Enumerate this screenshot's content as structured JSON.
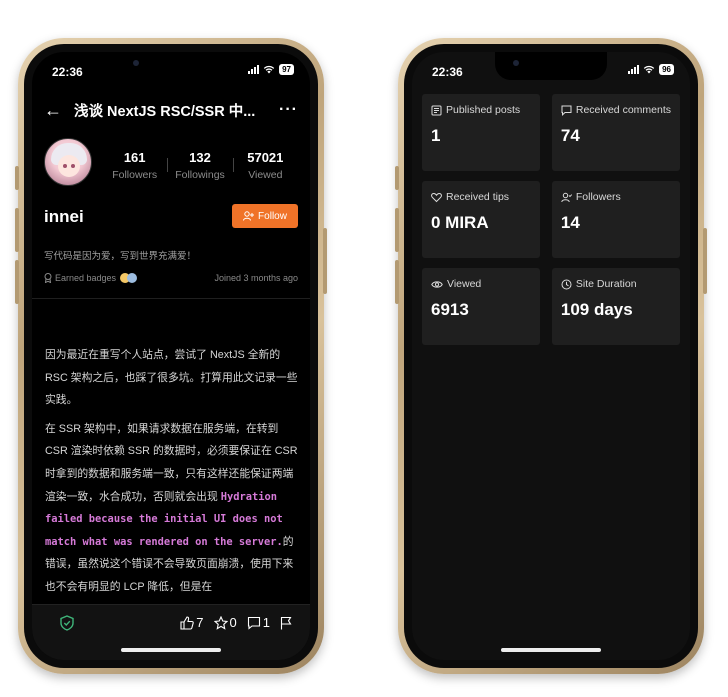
{
  "left_phone": {
    "status": {
      "time": "22:36",
      "battery": "97"
    },
    "header": {
      "back_icon": "arrow-left",
      "title": "浅谈 NextJS RSC/SSR 中...",
      "more_icon": "ellipsis"
    },
    "profile": {
      "stats": [
        {
          "value": "161",
          "label": "Followers"
        },
        {
          "value": "132",
          "label": "Followings"
        },
        {
          "value": "57021",
          "label": "Viewed"
        }
      ],
      "username": "innei",
      "follow_button": "Follow",
      "bio": "写代码是因为爱，写到世界充满爱！",
      "badges_label": "Earned badges",
      "joined": "Joined 3 months ago"
    },
    "article": {
      "p1": "因为最近在重写个人站点，尝试了 NextJS 全新的 RSC 架构之后，也踩了很多坑。打算用此文记录一些实践。",
      "p2_before": "在 SSR 架构中，如果请求数据在服务端，在转到 CSR 渲染时依赖 SSR 的数据时，必须要保证在 CSR 时拿到的数据和服务端一致，只有这样还能保证两端渲染一致，水合成功，否则就会出现 ",
      "p2_code": "Hydration failed because the initial UI does not match what was rendered on the server.",
      "p2_after": "的错误，虽然说这个错误不会导致页面崩溃，使用下来也不会有明显的 LCP 降低，但是在"
    },
    "actions": {
      "likes": "7",
      "stars": "0",
      "comments": "1"
    },
    "colors": {
      "accent": "#f07328",
      "code": "#d67ad8",
      "shield": "#3fb67a"
    }
  },
  "right_phone": {
    "status": {
      "time": "22:36",
      "battery": "96"
    },
    "cards": [
      {
        "icon": "posts-icon",
        "label": "Published posts",
        "value": "1"
      },
      {
        "icon": "comment-icon",
        "label": "Received comments",
        "value": "74"
      },
      {
        "icon": "heart-icon",
        "label": "Received tips",
        "value": "0 MIRA"
      },
      {
        "icon": "user-icon",
        "label": "Followers",
        "value": "14"
      },
      {
        "icon": "eye-icon",
        "label": "Viewed",
        "value": "6913"
      },
      {
        "icon": "clock-icon",
        "label": "Site Duration",
        "value": "109 days"
      }
    ]
  }
}
